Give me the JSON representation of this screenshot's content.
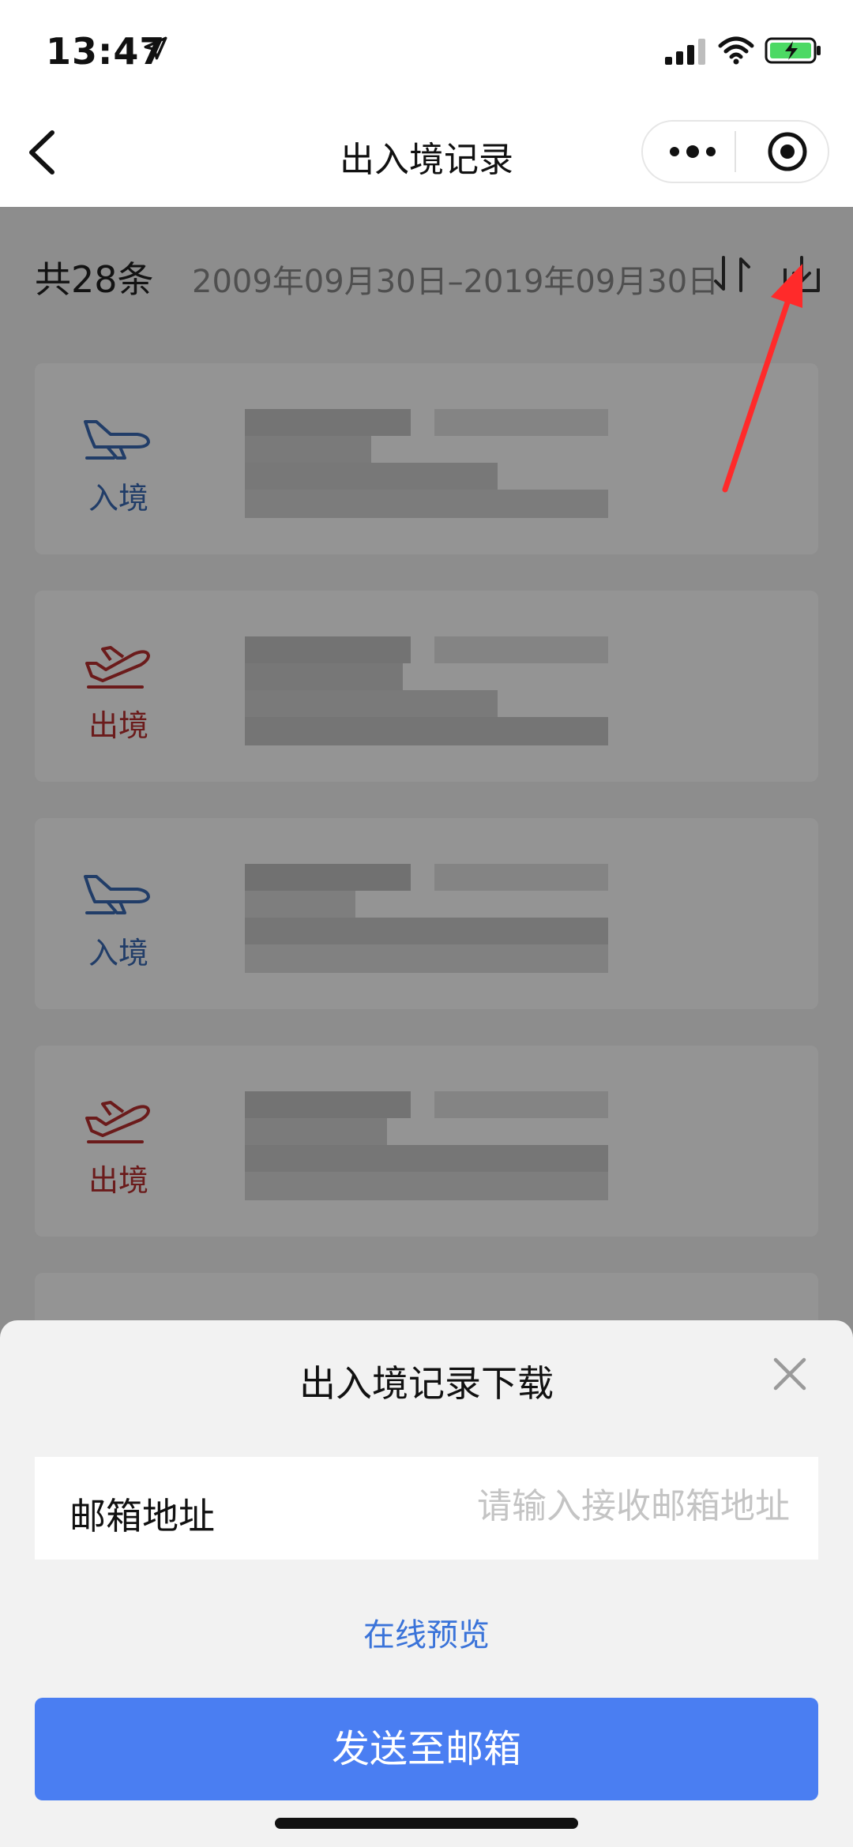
{
  "status_bar": {
    "time": "13:47"
  },
  "nav": {
    "title": "出入境记录"
  },
  "summary": {
    "count": "共28条",
    "date_range": "2009年09月30日–2019年09月30日"
  },
  "records": [
    {
      "type": "入境",
      "color": "#3a69b4"
    },
    {
      "type": "出境",
      "color": "#b83030"
    },
    {
      "type": "入境",
      "color": "#3a69b4"
    },
    {
      "type": "出境",
      "color": "#b83030"
    }
  ],
  "sheet": {
    "title": "出入境记录下载",
    "email_label": "邮箱地址",
    "email_placeholder": "请输入接收邮箱地址",
    "preview_link": "在线预览",
    "send_button": "发送至邮箱"
  },
  "colors": {
    "primary": "#4a7ef2",
    "link": "#3a73d9",
    "annotation": "#ff2a2a"
  }
}
